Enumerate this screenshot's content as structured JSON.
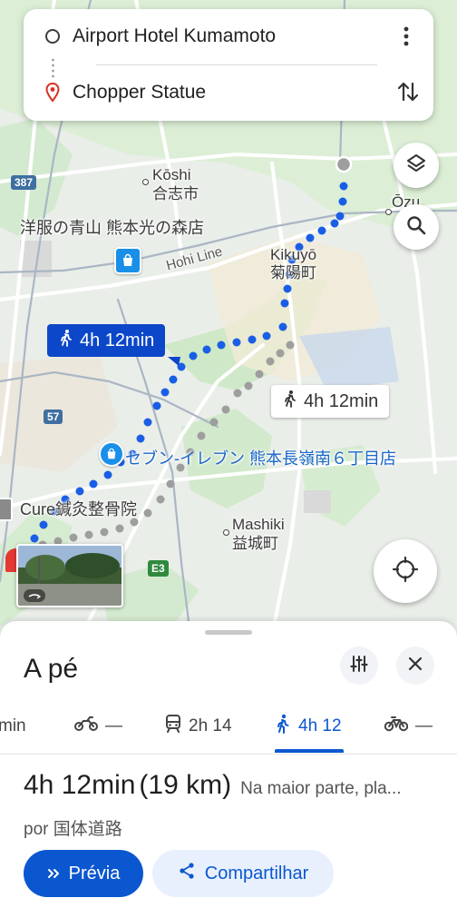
{
  "search": {
    "origin": "Airport Hotel Kumamoto",
    "destination": "Chopper Statue"
  },
  "map": {
    "labels": {
      "koshi_en": "Kōshi",
      "koshi_jp": "合志市",
      "ozu_en": "Ōzu",
      "store_aoyama": "洋服の青山 熊本光の森店",
      "kikuyo_en": "Kikuyō",
      "kikuyo_jp": "菊陽町",
      "hohi_line": "Hohi Line",
      "seven_eleven": "セブン-イレブン 熊本長嶺南６丁目店",
      "cure_clinic": "Cure鍼灸整骨院",
      "mashiki_en": "Mashiki",
      "mashiki_jp": "益城町"
    },
    "road_shields": {
      "r387": "387",
      "r57": "57",
      "e3": "E3"
    },
    "routes": {
      "selected_time": "4h 12min",
      "alternate_time": "4h 12min"
    },
    "colors": {
      "route_selected": "#1a5ee6",
      "route_alternate": "#9e9e9e"
    }
  },
  "sheet": {
    "mode_title": "A pé",
    "tabs": [
      {
        "icon": "car-icon",
        "label": "min"
      },
      {
        "icon": "motorcycle-icon",
        "label": "—"
      },
      {
        "icon": "train-icon",
        "label": "2h 14"
      },
      {
        "icon": "walk-icon",
        "label": "4h 12"
      },
      {
        "icon": "bicycle-icon",
        "label": "—"
      }
    ],
    "active_tab": "4h 12",
    "duration": "4h 12min",
    "distance": "(19 km)",
    "note": "Na maior parte, pla...",
    "via": "por 国体道路",
    "preview_label": "Prévia",
    "share_label": "Compartilhar"
  }
}
